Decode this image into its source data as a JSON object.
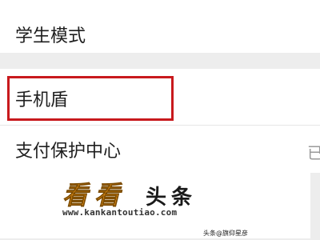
{
  "settings": {
    "rows": [
      {
        "label": "学生模式"
      },
      {
        "label": "手机盾",
        "highlighted": true
      },
      {
        "label": "支付保护中心",
        "trailing_text": "已"
      }
    ]
  },
  "highlight": {
    "color": "#c8191d"
  },
  "watermark": {
    "logo_text": "看看头条",
    "logo_chars": [
      "看",
      "看",
      "头",
      "条"
    ],
    "url": "www.kankantoutiao.com",
    "colors": {
      "kan": "#f39a1e",
      "toutiao": "#1a1a1a"
    }
  },
  "corner_stamp": "头条@旗仰星彦"
}
